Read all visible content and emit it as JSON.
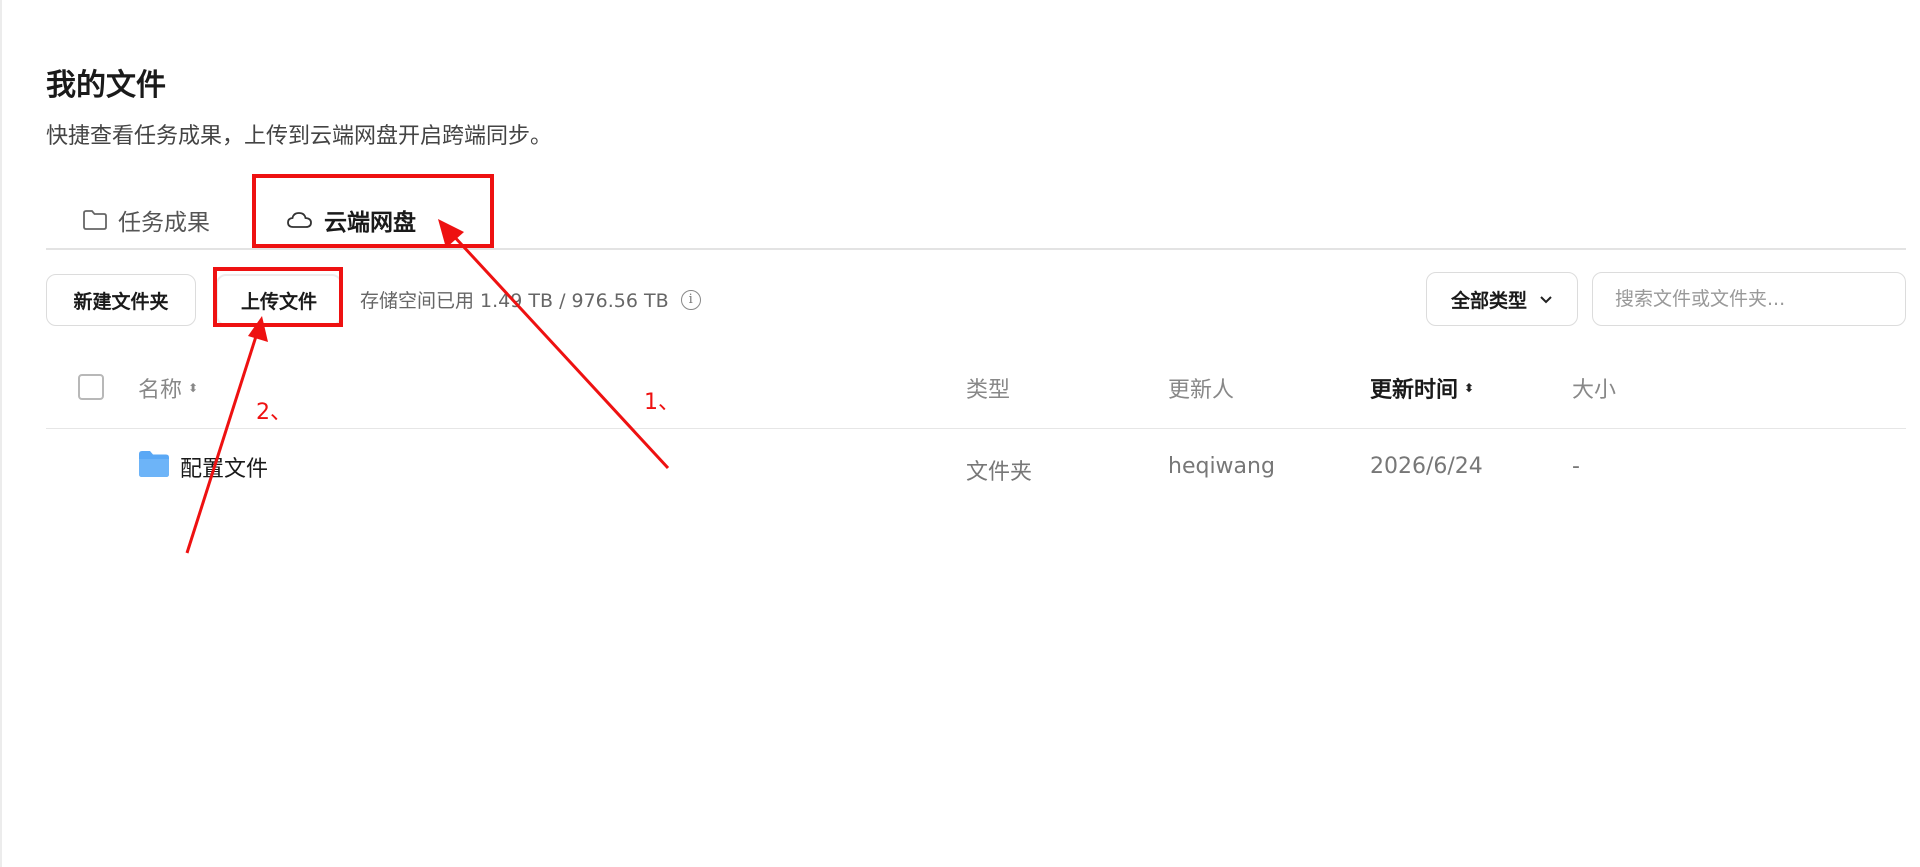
{
  "page": {
    "title": "我的文件",
    "subtitle": "快捷查看任务成果，上传到云端网盘开启跨端同步。"
  },
  "tabs": [
    {
      "label": "任务成果",
      "icon": "folder-icon",
      "active": false
    },
    {
      "label": "云端网盘",
      "icon": "cloud-icon",
      "active": true
    }
  ],
  "toolbar": {
    "new_folder_label": "新建文件夹",
    "upload_label": "上传文件",
    "storage_text": "存储空间已用 1.49 TB / 976.56 TB",
    "type_filter_value": "全部类型",
    "search_placeholder": "搜索文件或文件夹..."
  },
  "table": {
    "columns": {
      "name": "名称",
      "type": "类型",
      "updater": "更新人",
      "updated_time": "更新时间",
      "size": "大小"
    },
    "rows": [
      {
        "name": "配置文件",
        "type": "文件夹",
        "updater": "heqiwang",
        "updated_time": "2026/6/24",
        "size": "-",
        "icon": "folder-filled-icon"
      }
    ]
  },
  "annotations": {
    "label_1": "1、",
    "label_2": "2、",
    "color": "#ee1111"
  },
  "colors": {
    "folder_blue": "#5aa8f5",
    "annotation_red": "#ee1111"
  }
}
